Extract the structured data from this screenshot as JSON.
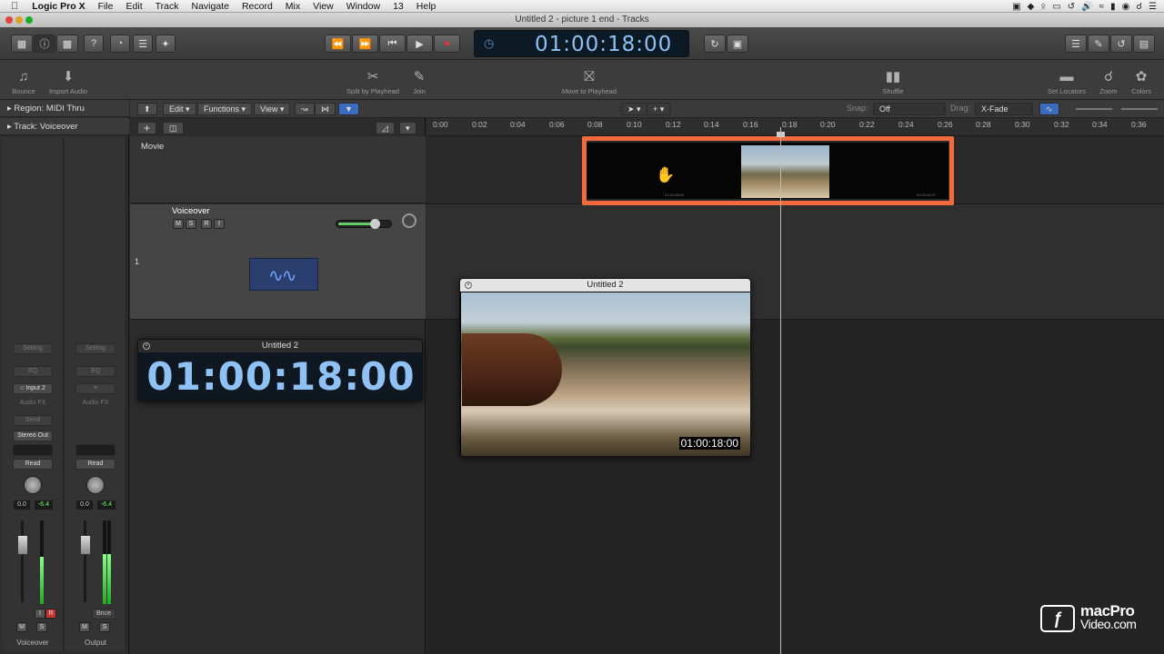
{
  "menubar": {
    "apple": "",
    "app": "Logic Pro X",
    "items": [
      "File",
      "Edit",
      "Track",
      "Navigate",
      "Record",
      "Mix",
      "View",
      "Window",
      "13",
      "Help"
    ]
  },
  "window": {
    "title": "Untitled 2 - picture 1 end - Tracks"
  },
  "transport": {
    "time": "01:00:18:00"
  },
  "toolbar": {
    "bounce": "Bounce",
    "import_audio": "Import Audio",
    "split": "Split by Playhead",
    "join": "Join",
    "move": "Move to Playhead",
    "shuffle": "Shuffle",
    "set_locators": "Set Locators",
    "zoom": "Zoom",
    "colors": "Colors"
  },
  "inspector": {
    "region": "Region: MIDI Thru",
    "track": "Track:  Voiceover",
    "strip1": {
      "setting": "Setting",
      "eq": "EQ",
      "input": "Input 2",
      "audio_fx": "Audio FX",
      "send": "Send",
      "output": "Stereo Out",
      "automation": "Read",
      "vol": "0.0",
      "peak": "-6.4",
      "i": "I",
      "r": "R",
      "m": "M",
      "s": "S",
      "name": "Voiceover"
    },
    "strip2": {
      "setting": "Setting",
      "eq": "EQ",
      "audio_fx": "Audio FX",
      "automation": "Read",
      "vol": "0.0",
      "peak": "-6.4",
      "bnce": "Bnce",
      "m": "M",
      "s": "S",
      "name": "Output"
    }
  },
  "tracks_header": {
    "edit": "Edit",
    "functions": "Functions",
    "view": "View",
    "snap_label": "Snap:",
    "snap_value": "Off",
    "drag_label": "Drag:",
    "drag_value": "X-Fade"
  },
  "tracks": {
    "movie": {
      "name": "Movie"
    },
    "voiceover": {
      "name": "Voiceover",
      "number": "1",
      "m": "M",
      "s": "S",
      "r": "R",
      "i": "I"
    }
  },
  "ruler": [
    "0:00",
    "0:02",
    "0:04",
    "0:06",
    "0:08",
    "0:10",
    "0:12",
    "0:14",
    "0:16",
    "0:18",
    "0:20",
    "0:22",
    "0:24",
    "0:26",
    "0:28",
    "0:30",
    "0:32",
    "0:34",
    "0:36"
  ],
  "film": {
    "tc_left": "01:00:08:00",
    "tc_right": "01:00:26:07"
  },
  "lcd_window": {
    "title": "Untitled 2",
    "time": "01:00:18:00"
  },
  "movie_window": {
    "title": "Untitled 2",
    "timecode": "01:00:18:00"
  },
  "logo": {
    "line1": "macPro",
    "line2": "Video.com"
  },
  "colors": {
    "highlight": "#f36a3c",
    "lcd_text": "#8fc1f5"
  }
}
